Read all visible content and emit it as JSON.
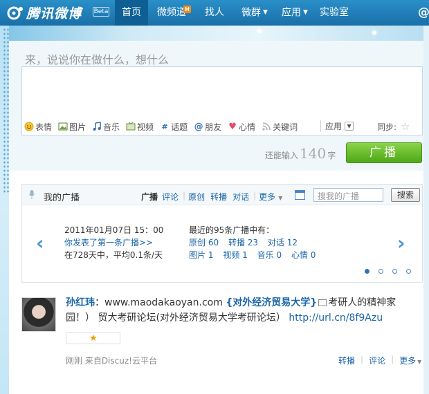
{
  "nav": {
    "logo_text": "腾讯微博",
    "beta": "Beta",
    "items": [
      {
        "label": "首页",
        "active": true
      },
      {
        "label": "微频道",
        "badge": "H"
      },
      {
        "label": "找人"
      },
      {
        "label": "微群",
        "caret": "▼"
      },
      {
        "label": "应用",
        "caret": "▼"
      },
      {
        "label": "实验室"
      }
    ],
    "at_symbol": "@"
  },
  "compose": {
    "prompt": "来，说说你在做什么，想什么",
    "tools": [
      {
        "icon": "smiley-icon",
        "label": "表情"
      },
      {
        "icon": "image-icon",
        "label": "图片"
      },
      {
        "icon": "music-icon",
        "label": "音乐"
      },
      {
        "icon": "video-icon",
        "label": "视频"
      },
      {
        "icon": "hashtag-icon",
        "label": "话题"
      },
      {
        "icon": "at-icon",
        "label": "朋友"
      },
      {
        "icon": "heart-icon",
        "label": "心情"
      },
      {
        "icon": "rss-icon",
        "label": "关键词"
      }
    ],
    "app_label": "应用",
    "sync_label": "同步:",
    "remain_prefix": "还能输入",
    "remain_num": "140",
    "remain_suffix": "字",
    "broadcast_label": "广播"
  },
  "mybroadcast": {
    "title": "我的广播",
    "tabs": [
      "广播",
      "评论",
      "原创",
      "转播",
      "对话"
    ],
    "more": "更多",
    "search_placeholder": "搜我的广播",
    "search_btn": "搜索",
    "first_date": "2011年01月07日  15：00",
    "first_link": "你发表了第一条广播>>",
    "avg": "在728天中，平均0.1条/天",
    "recent": "最近的95条广播中有：",
    "stats_row1": [
      {
        "k": "原创",
        "v": "60"
      },
      {
        "k": "转播",
        "v": "23"
      },
      {
        "k": "对话",
        "v": "12"
      }
    ],
    "stats_row2": [
      {
        "k": "图片",
        "v": "1"
      },
      {
        "k": "视频",
        "v": "1"
      },
      {
        "k": "音乐",
        "v": "0"
      },
      {
        "k": "心情",
        "v": "0"
      }
    ]
  },
  "post": {
    "author": "孙红玮",
    "colon": "：",
    "text1": "www.maodakaoyan.com ",
    "topic": "{对外经济贸易大学}",
    "text2": "考研人的精神家园！） 贸大考研论坛(对外经济贸易大学考研论坛）  ",
    "link": "http://url.cn/8f9Azu",
    "meta": "刚刚  来自Discuz!云平台",
    "actions": [
      "转播",
      "评论",
      "更多"
    ]
  }
}
